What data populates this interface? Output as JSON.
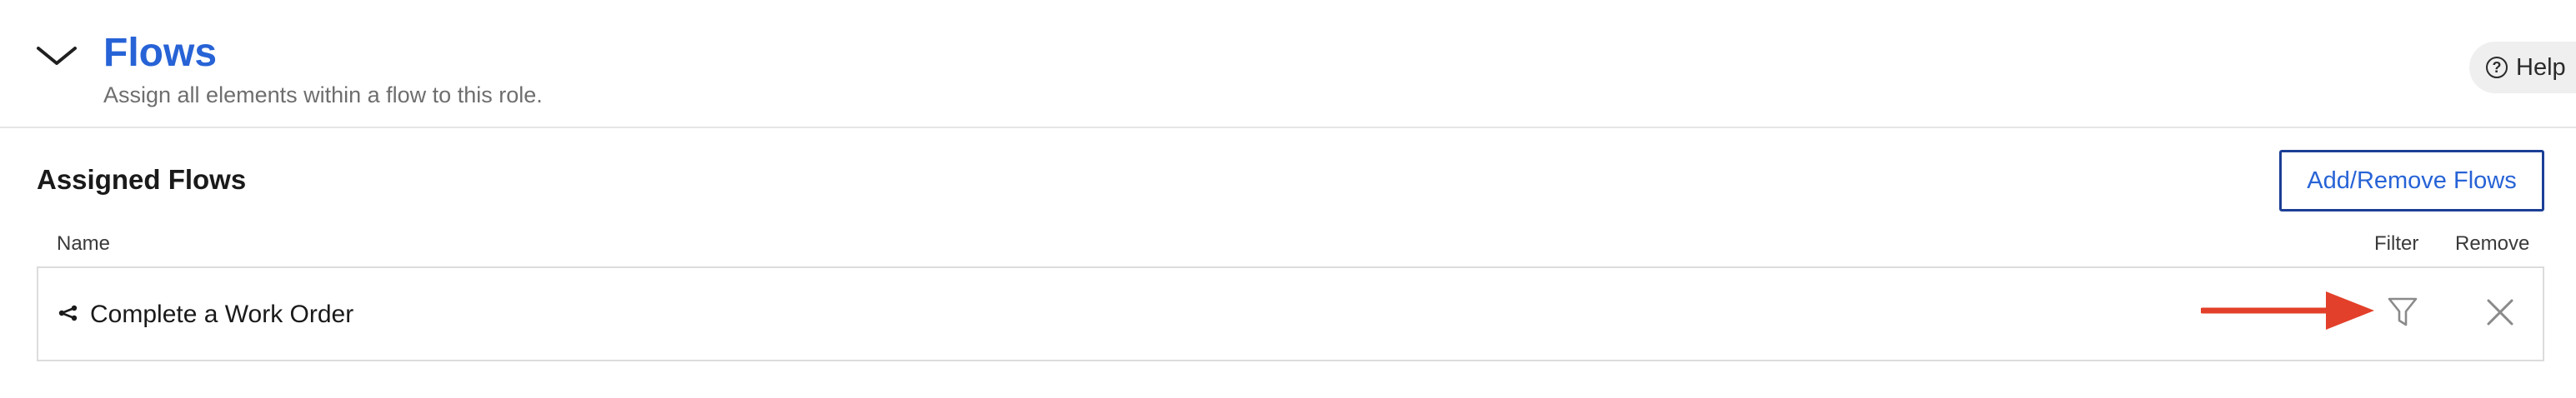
{
  "header": {
    "title": "Flows",
    "subtitle": "Assign all elements within a flow to this role.",
    "help_label": "Help",
    "help_icon": "question-circle-icon",
    "collapse_icon": "chevron-down-icon"
  },
  "section": {
    "title": "Assigned Flows",
    "add_button_label": "Add/Remove Flows"
  },
  "table": {
    "columns": {
      "name": "Name",
      "filter": "Filter",
      "remove": "Remove"
    },
    "rows": [
      {
        "name": "Complete a Work Order",
        "icon": "flow-icon"
      }
    ]
  },
  "annotation": {
    "arrow_color": "#e2402a",
    "arrow_icon": "red-arrow-right"
  },
  "colors": {
    "accent": "#2763d6",
    "button_border": "#1b3f95"
  }
}
